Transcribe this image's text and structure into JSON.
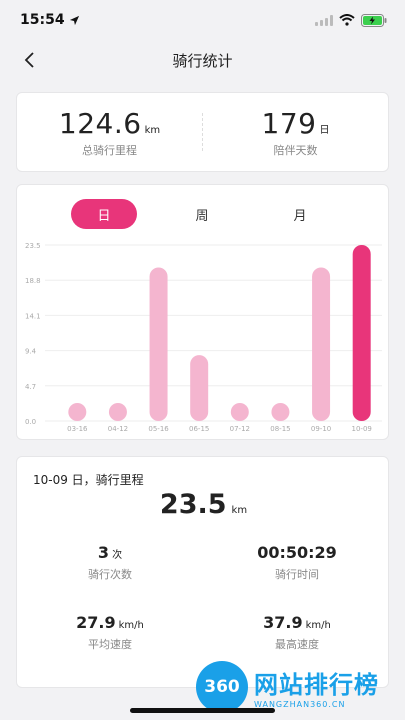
{
  "status": {
    "time": "15:54"
  },
  "nav": {
    "title": "骑行统计"
  },
  "summary": {
    "distance_value": "124.6",
    "distance_unit": "km",
    "distance_label": "总骑行里程",
    "days_value": "179",
    "days_unit": "日",
    "days_label": "陪伴天数"
  },
  "tabs": [
    {
      "label": "日"
    },
    {
      "label": "周"
    },
    {
      "label": "月"
    }
  ],
  "active_tab": 0,
  "colors": {
    "accent": "#e8357a",
    "bar": "#f4b5cf",
    "grid": "#eeeeee"
  },
  "chart_data": {
    "type": "bar",
    "categories": [
      "03-16",
      "04-12",
      "05-16",
      "06-15",
      "07-12",
      "08-15",
      "09-10",
      "10-09"
    ],
    "values": [
      1.3,
      1.3,
      20.5,
      8.8,
      1.3,
      1.3,
      20.5,
      23.5
    ],
    "y_ticks": [
      "0.0",
      "4.7",
      "9.4",
      "14.1",
      "18.8",
      "23.5"
    ],
    "ylim": [
      0,
      23.5
    ],
    "highlight_index": 7,
    "grid": true
  },
  "detail": {
    "heading": "10-09 日，骑行里程",
    "distance_value": "23.5",
    "distance_unit": "km",
    "rides_value": "3",
    "rides_unit": "次",
    "rides_label": "骑行次数",
    "time_value": "00:50:29",
    "time_label": "骑行时间",
    "avg_value": "27.9",
    "avg_unit": "km/h",
    "avg_label": "平均速度",
    "max_value": "37.9",
    "max_unit": "km/h",
    "max_label": "最高速度"
  },
  "watermark": {
    "logo": "360",
    "title": "网站排行榜",
    "sub": "WANGZHAN360.CN"
  }
}
